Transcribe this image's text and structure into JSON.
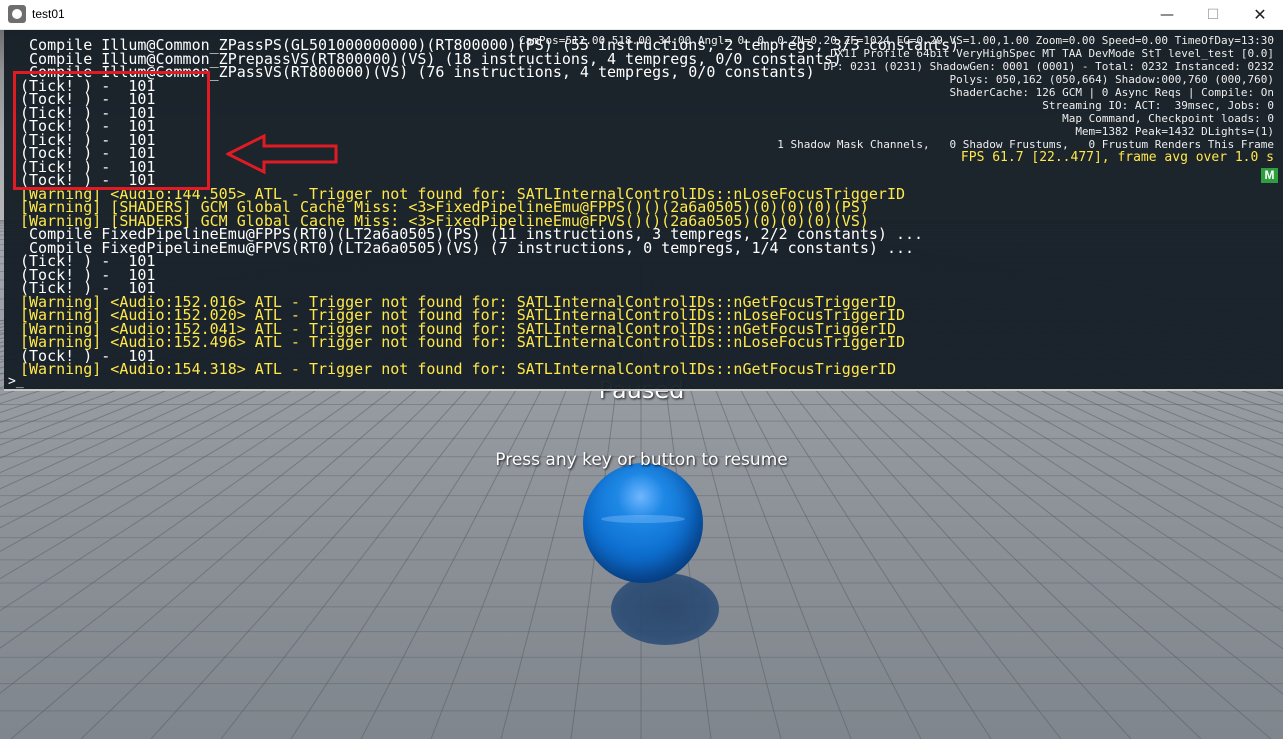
{
  "window": {
    "title": "test01",
    "minimize_label": "—",
    "maximize_label": "☐",
    "close_label": "✕"
  },
  "console": {
    "lines": [
      {
        "text": " Compile Illum@Common_ZPassPS(GL501000000000)(RT800000)(PS) (55 instructions, 2 tempregs, 3/3 constants)",
        "type": "normal"
      },
      {
        "text": " Compile Illum@Common_ZPrepassVS(RT800000)(VS) (18 instructions, 4 tempregs, 0/0 constants)",
        "type": "normal"
      },
      {
        "text": " Compile Illum@Common_ZPassVS(RT800000)(VS) (76 instructions, 4 tempregs, 0/0 constants)",
        "type": "normal"
      },
      {
        "text": "(Tick! ) -  101",
        "type": "normal"
      },
      {
        "text": "(Tock! ) -  101",
        "type": "normal"
      },
      {
        "text": "(Tick! ) -  101",
        "type": "normal"
      },
      {
        "text": "(Tock! ) -  101",
        "type": "normal"
      },
      {
        "text": "(Tick! ) -  101",
        "type": "normal"
      },
      {
        "text": "(Tock! ) -  101",
        "type": "normal"
      },
      {
        "text": "(Tick! ) -  101",
        "type": "normal"
      },
      {
        "text": "(Tock! ) -  101",
        "type": "normal"
      },
      {
        "text": "[Warning] <Audio:144.505> ATL - Trigger not found for: SATLInternalControlIDs::nLoseFocusTriggerID",
        "type": "warn"
      },
      {
        "text": "[Warning] [SHADERS] GCM Global Cache Miss: <3>FixedPipelineEmu@FPPS()()(2a6a0505)(0)(0)(0)(PS)",
        "type": "warn"
      },
      {
        "text": "[Warning] [SHADERS] GCM Global Cache Miss: <3>FixedPipelineEmu@FPVS()()(2a6a0505)(0)(0)(0)(VS)",
        "type": "warn"
      },
      {
        "text": " Compile FixedPipelineEmu@FPPS(RT0)(LT2a6a0505)(PS) (11 instructions, 3 tempregs, 2/2 constants) ...",
        "type": "normal"
      },
      {
        "text": " Compile FixedPipelineEmu@FPVS(RT0)(LT2a6a0505)(VS) (7 instructions, 0 tempregs, 1/4 constants) ...",
        "type": "normal"
      },
      {
        "text": "(Tick! ) -  101",
        "type": "normal"
      },
      {
        "text": "(Tock! ) -  101",
        "type": "normal"
      },
      {
        "text": "(Tick! ) -  101",
        "type": "normal"
      },
      {
        "text": "[Warning] <Audio:152.016> ATL - Trigger not found for: SATLInternalControlIDs::nGetFocusTriggerID",
        "type": "warn"
      },
      {
        "text": "[Warning] <Audio:152.020> ATL - Trigger not found for: SATLInternalControlIDs::nLoseFocusTriggerID",
        "type": "warn"
      },
      {
        "text": "[Warning] <Audio:152.041> ATL - Trigger not found for: SATLInternalControlIDs::nGetFocusTriggerID",
        "type": "warn"
      },
      {
        "text": "[Warning] <Audio:152.496> ATL - Trigger not found for: SATLInternalControlIDs::nLoseFocusTriggerID",
        "type": "warn"
      },
      {
        "text": "(Tock! ) -  101",
        "type": "normal"
      },
      {
        "text": "[Warning] <Audio:154.318> ATL - Trigger not found for: SATLInternalControlIDs::nGetFocusTriggerID",
        "type": "warn"
      }
    ],
    "prompt": ">_"
  },
  "stats": {
    "lines": [
      "CamPos=512.00 518.00 34.00 Angl= 0  0  0 ZN=0.20 ZF=1024 FC=0.29 VS=1.00,1.00 Zoom=0.00 Speed=0.00 TimeOfDay=13:30",
      "DX11 Profile 64bit VeryHighSpec MT TAA DevMode StT level_test [0.0]",
      "DP: 0231 (0231) ShadowGen: 0001 (0001) - Total: 0232 Instanced: 0232",
      "Polys: 050,162 (050,664) Shadow:000,760 (000,760)",
      "ShaderCache: 126 GCM | 0 Async Reqs | Compile: On",
      "Streaming IO: ACT:  39msec, Jobs: 0",
      "Map Command, Checkpoint loads: 0",
      "Mem=1382 Peak=1432 DLights=(1)",
      "1 Shadow Mask Channels,   0 Shadow Frustums,   0 Frustum Renders This Frame"
    ],
    "fps": "FPS 61.7 [22..477], frame avg over 1.0 s",
    "badge": "M"
  },
  "game": {
    "paused_text": "Paused",
    "resume_text": "Press any key or button to resume"
  },
  "colors": {
    "console_bg": "#161e26",
    "console_text": "#ffffff",
    "warning_text": "#ffe84a",
    "annotation_red": "#e01b23",
    "sphere_blue": "#1e88e5",
    "badge_green": "#2e9e3e"
  },
  "icons": {
    "app": "game-engine-logo-icon",
    "annotation": "red-outline-arrow-left-icon"
  }
}
